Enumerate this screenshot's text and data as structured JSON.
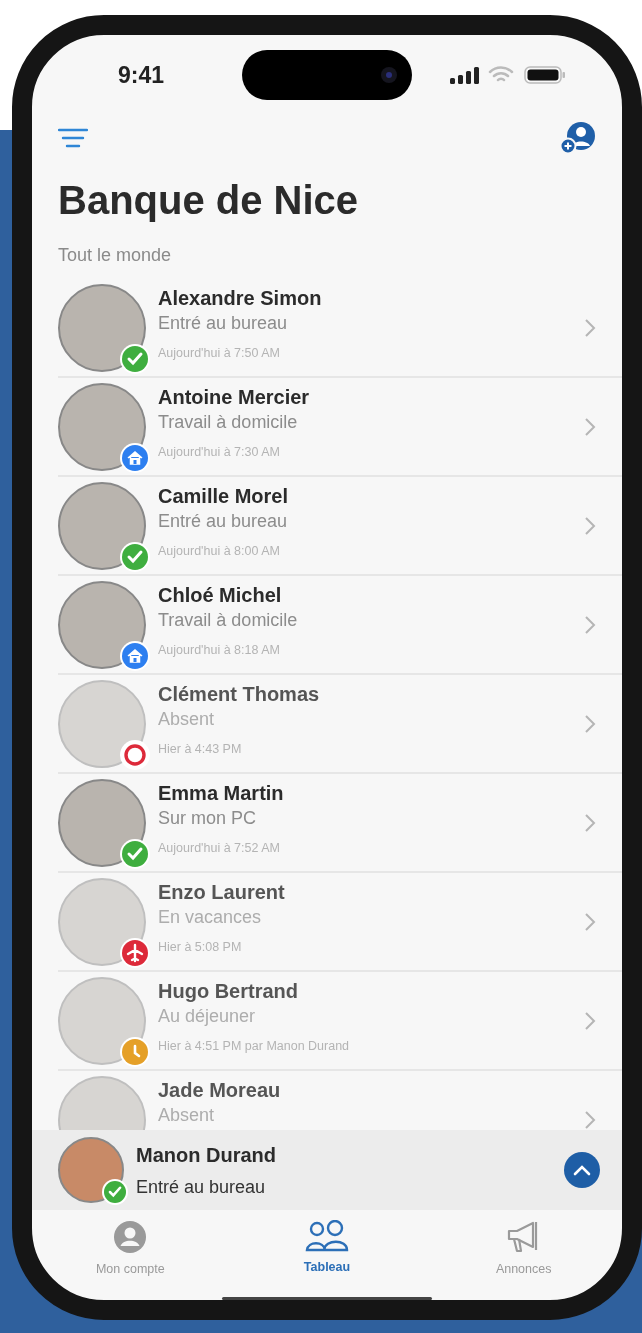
{
  "status_bar": {
    "time": "9:41"
  },
  "header": {
    "title": "Banque de Nice",
    "section": "Tout le monde"
  },
  "people": [
    {
      "name": "Alexandre Simon",
      "status": "Entré au bureau",
      "time": "Aujourd'hui à 7:50 AM",
      "kind": "office",
      "away": false
    },
    {
      "name": "Antoine Mercier",
      "status": "Travail à domicile",
      "time": "Aujourd'hui à 7:30 AM",
      "kind": "home",
      "away": false
    },
    {
      "name": "Camille Morel",
      "status": "Entré au bureau",
      "time": "Aujourd'hui à 8:00 AM",
      "kind": "office",
      "away": false
    },
    {
      "name": "Chloé Michel",
      "status": "Travail à domicile",
      "time": "Aujourd'hui à 8:18 AM",
      "kind": "home",
      "away": false
    },
    {
      "name": "Clément Thomas",
      "status": "Absent",
      "time": "Hier à 4:43 PM",
      "kind": "absent",
      "away": true
    },
    {
      "name": "Emma Martin",
      "status": "Sur mon PC",
      "time": "Aujourd'hui à 7:52 AM",
      "kind": "office",
      "away": false
    },
    {
      "name": "Enzo Laurent",
      "status": "En vacances",
      "time": "Hier à 5:08 PM",
      "kind": "vacation",
      "away": true
    },
    {
      "name": "Hugo Bertrand",
      "status": "Au déjeuner",
      "time": "Hier à 4:51 PM par Manon Durand",
      "kind": "lunch",
      "away": true
    },
    {
      "name": "Jade Moreau",
      "status": "Absent",
      "away": true
    }
  ],
  "current_user": {
    "name": "Manon Durand",
    "status": "Entré au bureau",
    "kind": "office"
  },
  "tabs": [
    {
      "label": "Mon compte",
      "kind": "account",
      "selected": false
    },
    {
      "label": "Tableau",
      "kind": "board",
      "selected": true
    },
    {
      "label": "Annonces",
      "kind": "announcements",
      "selected": false
    }
  ]
}
